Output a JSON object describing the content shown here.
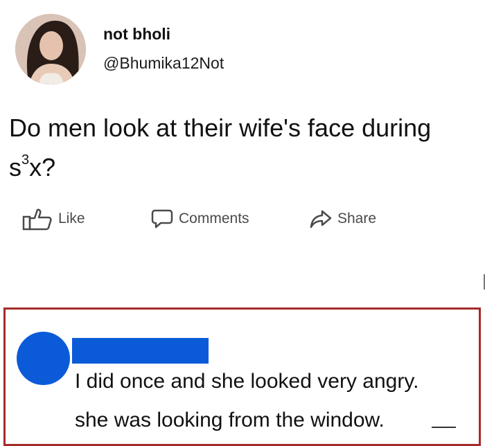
{
  "post": {
    "author_name": "not bholi",
    "author_handle": "@Bhumika12Not",
    "text_before_sup": "Do men look at their wife's face during s",
    "text_sup": "3",
    "text_after_sup": "x?"
  },
  "actions": {
    "like_label": "Like",
    "comments_label": "Comments",
    "share_label": "Share"
  },
  "comment": {
    "line1": "I did once and she looked very angry.",
    "line2": "she was looking from the window."
  },
  "colors": {
    "highlight_border": "#a52a2a",
    "redaction_blue": "#0b5bd8"
  }
}
